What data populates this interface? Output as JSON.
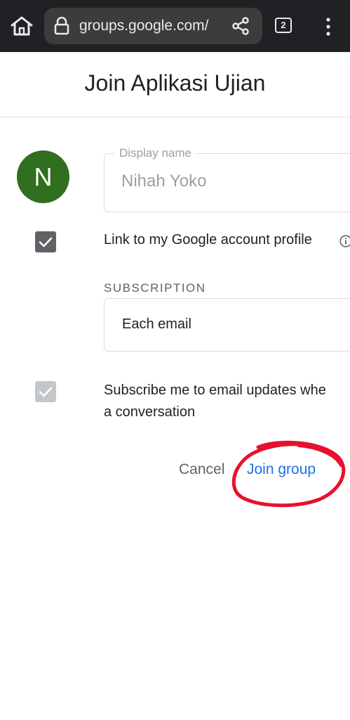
{
  "browser": {
    "url": "groups.google.com/",
    "tab_count": "2"
  },
  "page": {
    "title": "Join Aplikasi Ujian"
  },
  "form": {
    "avatar_initial": "N",
    "display_name_label": "Display name",
    "display_name_value": "Nihah Yoko",
    "link_profile_label": "Link to my Google account profile",
    "link_profile_checked": true,
    "subscription_label": "SUBSCRIPTION",
    "subscription_value": "Each email",
    "subscribe_updates_label_1": "Subscribe me to email updates whe",
    "subscribe_updates_label_2": "a conversation",
    "subscribe_updates_checked": true
  },
  "actions": {
    "cancel_label": "Cancel",
    "join_label": "Join group"
  },
  "colors": {
    "avatar": "#2f6f1f",
    "accent": "#1a73e8",
    "annotation": "#e8112d"
  }
}
